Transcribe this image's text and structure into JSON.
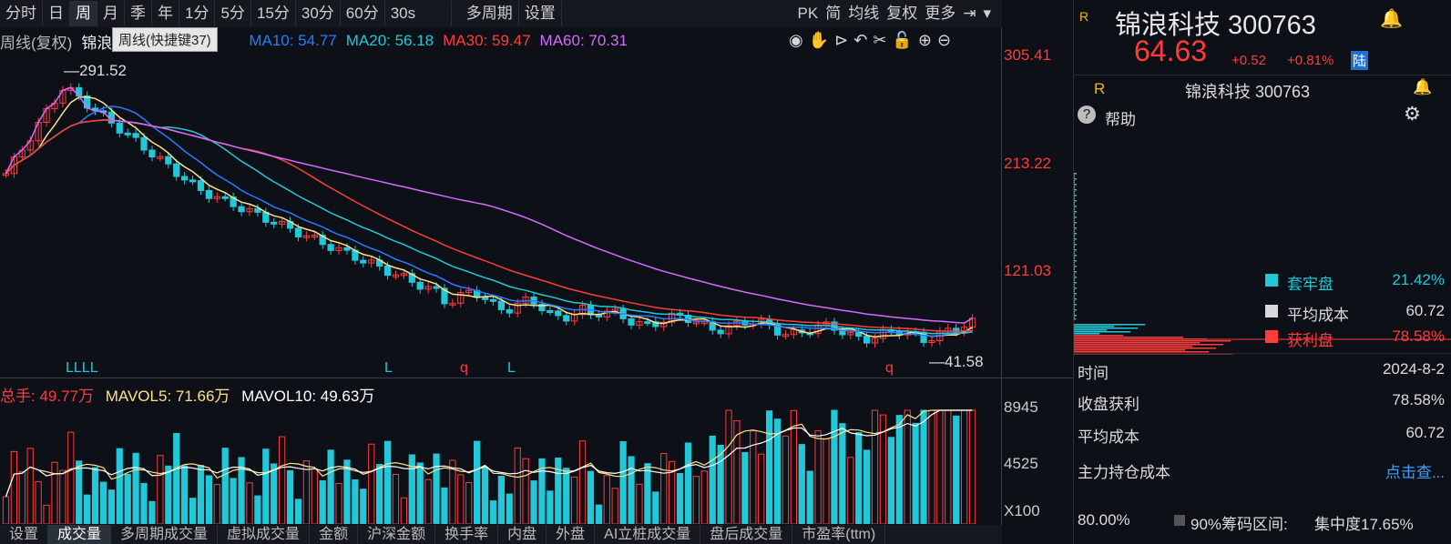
{
  "toolbar": {
    "periods": [
      "分时",
      "日",
      "周",
      "月",
      "季",
      "年",
      "1分",
      "5分",
      "15分",
      "30分",
      "60分",
      "30s"
    ],
    "active_period": "周",
    "multi": "多周期",
    "settings": "设置",
    "right": [
      "PK",
      "简",
      "均线",
      "复权",
      "更多"
    ]
  },
  "ma_line": {
    "prefix": "周线(复权)",
    "name": "锦浪",
    "ma10": "MA10: 54.77",
    "ma20": "MA20: 56.18",
    "ma30": "MA30: 59.47",
    "ma60": "MA60: 70.31"
  },
  "tooltip": "周线(快捷键37)",
  "price_axis": {
    "p1": "305.41",
    "p2": "213.22",
    "p3": "121.03"
  },
  "annotations": {
    "high": "291.52",
    "low": "41.58",
    "llll": "LLLL",
    "l1": "L",
    "q1": "q",
    "l2": "L",
    "q2": "q"
  },
  "volume": {
    "header_a": "总手: 49.77万",
    "mavol5": "MAVOL5: 71.66万",
    "mavol10": "MAVOL10: 49.63万",
    "axis1": "8945",
    "axis2": "4525",
    "unit": "X100"
  },
  "bottom_tabs": [
    "设置",
    "成交量",
    "多周期成交量",
    "虚拟成交量",
    "金额",
    "沪深金额",
    "换手率",
    "内盘",
    "外盘",
    "AI立桩成交量",
    "盘后成交量",
    "市盈率(ttm)"
  ],
  "active_tab": "成交量",
  "quote": {
    "marker": "R",
    "title": "锦浪科技 300763",
    "price": "64.63",
    "change": "+0.52",
    "pct": "+0.81%",
    "lu": "陆"
  },
  "chip": {
    "marker": "R",
    "title": "锦浪科技 300763",
    "help": "帮助",
    "legend": [
      {
        "label": "套牢盘",
        "value": "21.42%",
        "color": "#22c7d8"
      },
      {
        "label": "平均成本",
        "value": "60.72",
        "color": "#d8d8d8"
      },
      {
        "label": "获利盘",
        "value": "78.58%",
        "color": "#ff3c3c"
      }
    ],
    "rows": [
      {
        "label": "时间",
        "value": "2024-8-2"
      },
      {
        "label": "收盘获利",
        "value": "78.58%"
      },
      {
        "label": "平均成本",
        "value": "60.72"
      },
      {
        "label": "主力持仓成本",
        "value": "点击查..."
      }
    ],
    "footer_left": "80.00%",
    "footer_mid": "90%筹码区间:",
    "footer_right": "集中度17.65%"
  },
  "colors": {
    "up": "#ff3c3c",
    "down": "#22c7d8",
    "ma5": "#ffe08a",
    "ma10": "#2a7bff",
    "ma20": "#22c7d8",
    "ma30": "#ff3c3c",
    "ma60": "#d36cff"
  }
}
